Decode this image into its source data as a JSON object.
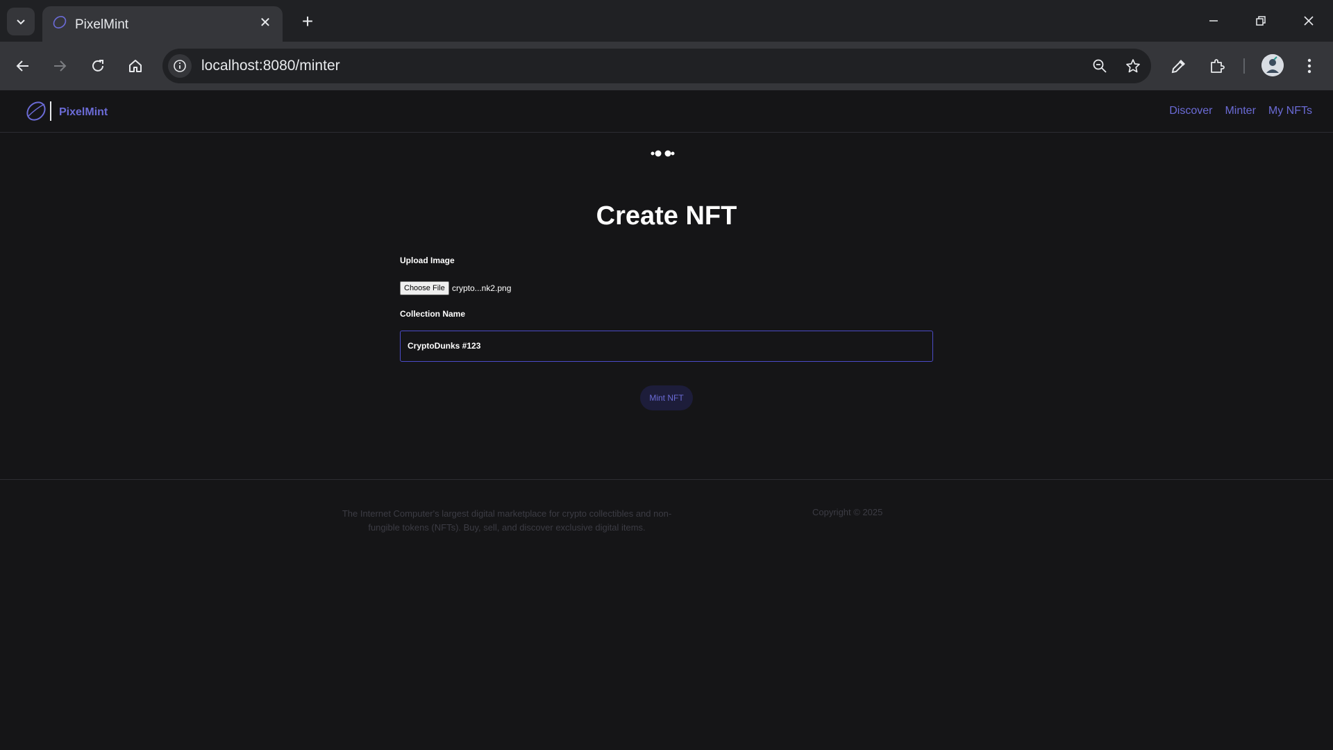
{
  "browser": {
    "tab_title": "PixelMint",
    "url": "localhost:8080/minter"
  },
  "navbar": {
    "brand": "PixelMint",
    "links": [
      "Discover",
      "Minter",
      "My NFTs"
    ]
  },
  "form": {
    "title": "Create NFT",
    "upload_label": "Upload Image",
    "choose_file_label": "Choose File",
    "file_name": "crypto...nk2.png",
    "collection_label": "Collection Name",
    "collection_value": "CryptoDunks #123",
    "mint_label": "Mint NFT"
  },
  "footer": {
    "description": "The Internet Computer's largest digital marketplace for crypto collectibles and non-fungible tokens (NFTs). Buy, sell, and discover exclusive digital items.",
    "copyright": "Copyright © 2025"
  },
  "colors": {
    "accent": "#6b6bd6",
    "background": "#151517",
    "chrome": "#35363a"
  }
}
